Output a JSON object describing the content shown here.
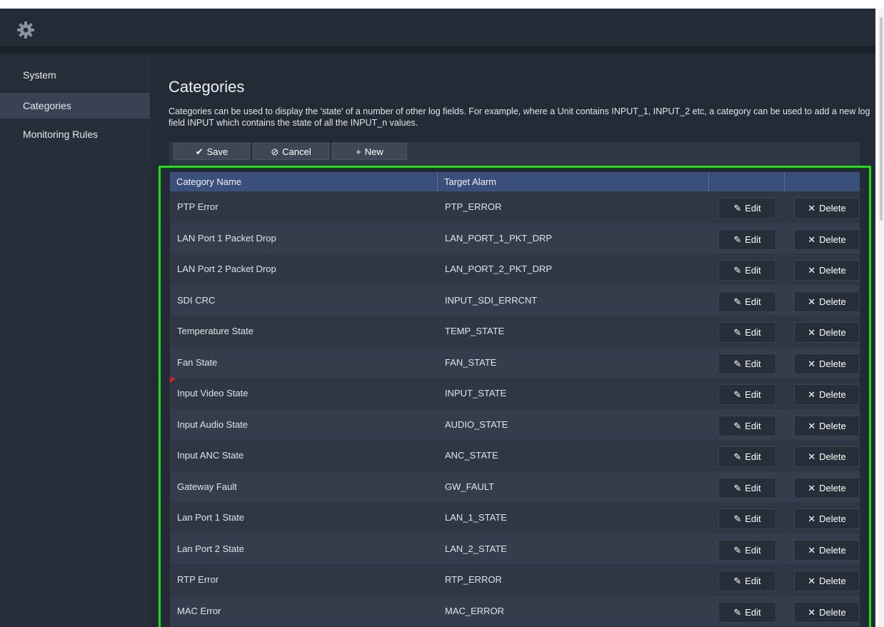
{
  "colors": {
    "highlight": "#1edf16",
    "header": "#3a4f7a",
    "flag": "#e02020"
  },
  "topbar": {
    "settings_icon": "gear-icon"
  },
  "sidebar": {
    "items": [
      {
        "label": "System"
      },
      {
        "label": "Categories"
      },
      {
        "label": "Monitoring Rules"
      }
    ]
  },
  "page": {
    "title": "Categories",
    "description": "Categories can be used to display the 'state' of a number of other log fields. For example, where a Unit contains INPUT_1, INPUT_2 etc, a category can be used to add a new log field INPUT which contains the state of all the INPUT_n values."
  },
  "toolbar": {
    "save": {
      "icon": "✔",
      "label": "Save"
    },
    "cancel": {
      "icon": "⊘",
      "label": "Cancel"
    },
    "new": {
      "icon": "+",
      "label": "New"
    }
  },
  "table": {
    "columns": [
      "Category Name",
      "Target Alarm",
      "",
      ""
    ],
    "edit_label": "Edit",
    "edit_icon": "✎",
    "delete_label": "Delete",
    "delete_icon": "✕",
    "rows": [
      {
        "name": "PTP Error",
        "alarm": "PTP_ERROR"
      },
      {
        "name": "LAN Port 1 Packet Drop",
        "alarm": "LAN_PORT_1_PKT_DRP"
      },
      {
        "name": "LAN Port 2 Packet Drop",
        "alarm": "LAN_PORT_2_PKT_DRP"
      },
      {
        "name": "SDI CRC",
        "alarm": "INPUT_SDI_ERRCNT"
      },
      {
        "name": "Temperature State",
        "alarm": "TEMP_STATE"
      },
      {
        "name": "Fan State",
        "alarm": "FAN_STATE"
      },
      {
        "name": "Input Video State",
        "alarm": "INPUT_STATE",
        "flag": true
      },
      {
        "name": "Input Audio State",
        "alarm": "AUDIO_STATE"
      },
      {
        "name": "Input ANC State",
        "alarm": "ANC_STATE"
      },
      {
        "name": "Gateway Fault",
        "alarm": "GW_FAULT"
      },
      {
        "name": "Lan Port 1 State",
        "alarm": "LAN_1_STATE"
      },
      {
        "name": "Lan Port 2 State",
        "alarm": "LAN_2_STATE"
      },
      {
        "name": "RTP Error",
        "alarm": "RTP_ERROR"
      },
      {
        "name": "MAC Error",
        "alarm": "MAC_ERROR"
      }
    ]
  }
}
